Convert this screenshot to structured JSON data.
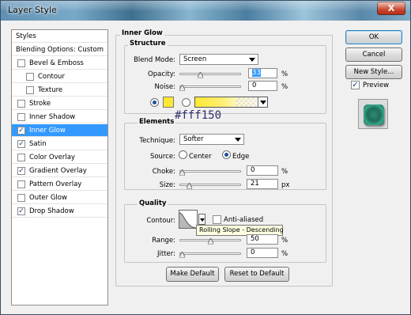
{
  "window": {
    "title": "Layer Style",
    "close_label": "X"
  },
  "styles_list": {
    "header": "Styles",
    "blending": "Blending Options: Custom",
    "items": [
      {
        "label": "Bevel & Emboss",
        "checked": false,
        "indent": false
      },
      {
        "label": "Contour",
        "checked": false,
        "indent": true
      },
      {
        "label": "Texture",
        "checked": false,
        "indent": true
      },
      {
        "label": "Stroke",
        "checked": false,
        "indent": false
      },
      {
        "label": "Inner Shadow",
        "checked": false,
        "indent": false
      },
      {
        "label": "Inner Glow",
        "checked": true,
        "indent": false,
        "selected": true
      },
      {
        "label": "Satin",
        "checked": true,
        "indent": false
      },
      {
        "label": "Color Overlay",
        "checked": false,
        "indent": false
      },
      {
        "label": "Gradient Overlay",
        "checked": true,
        "indent": false
      },
      {
        "label": "Pattern Overlay",
        "checked": false,
        "indent": false
      },
      {
        "label": "Outer Glow",
        "checked": false,
        "indent": false
      },
      {
        "label": "Drop Shadow",
        "checked": true,
        "indent": false
      }
    ]
  },
  "panel": {
    "title": "Inner Glow",
    "structure": {
      "title": "Structure",
      "blend_mode_label": "Blend Mode:",
      "blend_mode_value": "Screen",
      "opacity_label": "Opacity:",
      "opacity_value": "33",
      "opacity_percent": 33,
      "noise_label": "Noise:",
      "noise_value": "0",
      "noise_percent": 0,
      "unit_percent": "%",
      "color_swatch": "#ffe833"
    },
    "elements": {
      "title": "Elements",
      "annotation": "#fff150",
      "technique_label": "Technique:",
      "technique_value": "Softer",
      "source_label": "Source:",
      "source_center": "Center",
      "source_edge": "Edge",
      "source_selected": "Edge",
      "choke_label": "Choke:",
      "choke_value": "0",
      "choke_percent": 0,
      "size_label": "Size:",
      "size_value": "21",
      "size_unit": "px"
    },
    "quality": {
      "title": "Quality",
      "contour_label": "Contour:",
      "anti_aliased_label": "Anti-aliased",
      "anti_aliased": false,
      "tooltip": "Rolling Slope - Descending",
      "range_label": "Range:",
      "range_value": "50",
      "range_percent": 50,
      "jitter_label": "Jitter:",
      "jitter_value": "0",
      "jitter_percent": 0
    },
    "make_default": "Make Default",
    "reset_default": "Reset to Default"
  },
  "buttons": {
    "ok": "OK",
    "cancel": "Cancel",
    "new_style": "New Style...",
    "preview_label": "Preview",
    "preview_checked": true
  }
}
